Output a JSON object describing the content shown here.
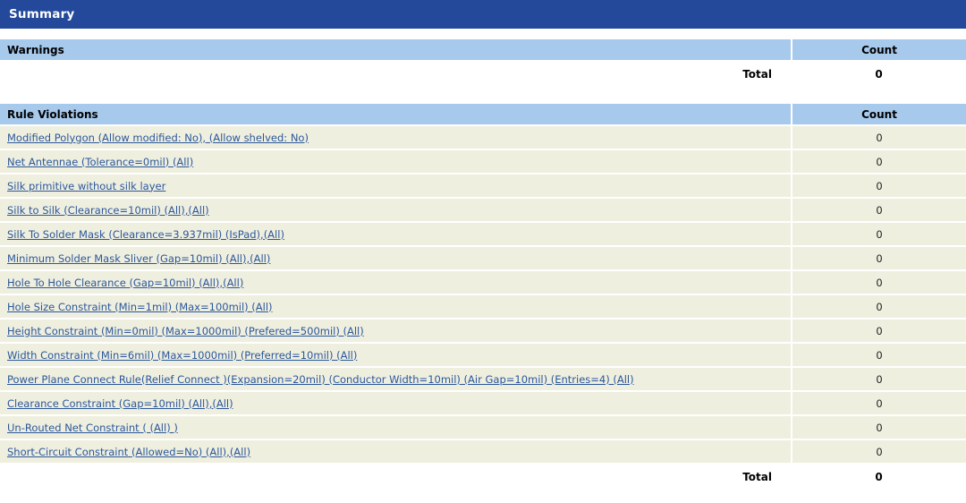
{
  "header": {
    "title": "Summary"
  },
  "warnings_table": {
    "section_label": "Warnings",
    "count_label": "Count",
    "rows": [],
    "total_label": "Total",
    "total_value": "0"
  },
  "rule_violations_table": {
    "section_label": "Rule Violations",
    "count_label": "Count",
    "rows": [
      {
        "name": "Modified Polygon (Allow modified: No), (Allow shelved: No)",
        "count": "0"
      },
      {
        "name": "Net Antennae (Tolerance=0mil) (All)",
        "count": "0"
      },
      {
        "name": "Silk primitive without silk layer",
        "count": "0"
      },
      {
        "name": "Silk to Silk (Clearance=10mil) (All),(All)",
        "count": "0"
      },
      {
        "name": "Silk To Solder Mask (Clearance=3.937mil) (IsPad),(All)",
        "count": "0"
      },
      {
        "name": "Minimum Solder Mask Sliver (Gap=10mil) (All),(All)",
        "count": "0"
      },
      {
        "name": "Hole To Hole Clearance (Gap=10mil) (All),(All)",
        "count": "0"
      },
      {
        "name": "Hole Size Constraint (Min=1mil) (Max=100mil) (All)",
        "count": "0"
      },
      {
        "name": "Height Constraint (Min=0mil) (Max=1000mil) (Prefered=500mil) (All)",
        "count": "0"
      },
      {
        "name": "Width Constraint (Min=6mil) (Max=1000mil) (Preferred=10mil) (All)",
        "count": "0"
      },
      {
        "name": "Power Plane Connect Rule(Relief Connect )(Expansion=20mil) (Conductor Width=10mil) (Air Gap=10mil) (Entries=4) (All)",
        "count": "0"
      },
      {
        "name": "Clearance Constraint (Gap=10mil) (All),(All)",
        "count": "0"
      },
      {
        "name": "Un-Routed Net Constraint ( (All) )",
        "count": "0"
      },
      {
        "name": "Short-Circuit Constraint (Allowed=No) (All),(All)",
        "count": "0"
      }
    ],
    "total_label": "Total",
    "total_value": "0"
  },
  "colors": {
    "title_bar": "#24499B",
    "section_header": "#A6C9EC",
    "row_background": "#EFEFE0",
    "link": "#2B579A",
    "page_background": "#FFFFFF"
  }
}
